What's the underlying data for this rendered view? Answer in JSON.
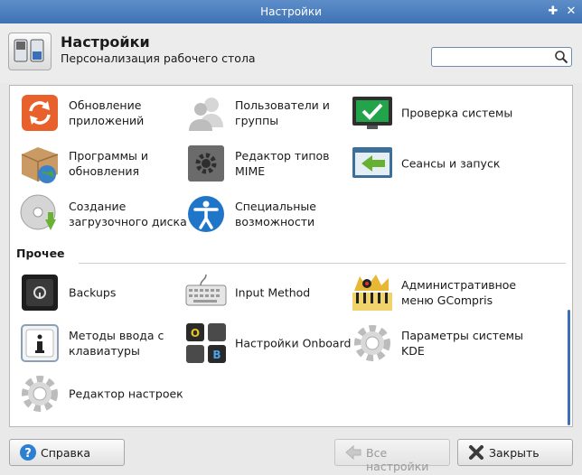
{
  "window": {
    "title": "Настройки"
  },
  "header": {
    "title": "Настройки",
    "subtitle": "Персонализация рабочего стола"
  },
  "search": {
    "value": "",
    "placeholder": ""
  },
  "section_personal": {
    "items": [
      {
        "label": "Обновление приложений",
        "icon": "refresh-icon"
      },
      {
        "label": "Пользователи и группы",
        "icon": "users-icon"
      },
      {
        "label": "Проверка системы",
        "icon": "check-monitor-icon"
      },
      {
        "label": "Программы и обновления",
        "icon": "software-box-icon"
      },
      {
        "label": "Редактор типов MIME",
        "icon": "mime-gear-icon"
      },
      {
        "label": "Сеансы и запуск",
        "icon": "session-window-icon"
      },
      {
        "label": "Создание загрузочного диска",
        "icon": "boot-disk-icon"
      },
      {
        "label": "Специальные возможности",
        "icon": "accessibility-icon"
      }
    ]
  },
  "section_other": {
    "title": "Прочее",
    "items": [
      {
        "label": "Backups",
        "icon": "safe-icon"
      },
      {
        "label": "Input Method",
        "icon": "keyboard-icon"
      },
      {
        "label": "Административное меню GCompris",
        "icon": "gcompris-icon"
      },
      {
        "label": "Методы ввода с клавиатуры",
        "icon": "info-icon"
      },
      {
        "label": "Настройки Onboard",
        "icon": "onboard-keys-icon"
      },
      {
        "label": "Параметры системы KDE",
        "icon": "kde-gear-icon"
      },
      {
        "label": "Редактор настроек",
        "icon": "settings-gear-icon"
      }
    ]
  },
  "footer": {
    "help_label": "Справка",
    "all_settings_label": "Все настройки",
    "close_label": "Закрыть"
  },
  "colors": {
    "titlebar": "#4a7dbf",
    "accent": "#3b6fb6"
  }
}
